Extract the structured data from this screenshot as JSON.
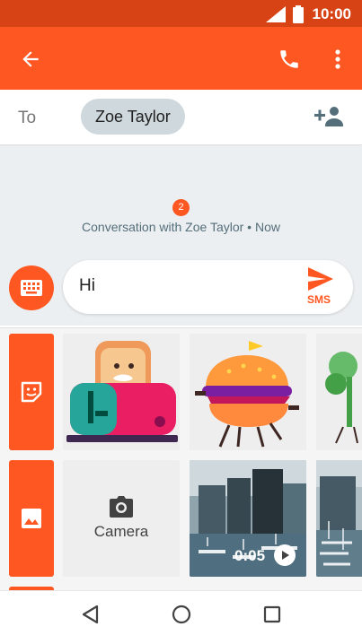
{
  "status_bar": {
    "time": "10:00",
    "icons": [
      "signal-icon",
      "battery-icon"
    ]
  },
  "colors": {
    "primary": "#ff5722",
    "status": "#d84315",
    "chip": "#cfd8dc",
    "background": "#eceff1"
  },
  "app_bar": {
    "icons": [
      "back-arrow-icon",
      "phone-icon",
      "more-vert-icon"
    ]
  },
  "to_row": {
    "label": "To",
    "recipient": "Zoe Taylor",
    "icon": "add-person-icon"
  },
  "conversation": {
    "badge": "2",
    "title": "Conversation with Zoe Taylor • Now"
  },
  "compose": {
    "value": "Hi",
    "send_label": "SMS",
    "icons": [
      "keyboard-icon",
      "send-icon"
    ]
  },
  "media": {
    "tabs": [
      "sticker-icon",
      "image-icon"
    ],
    "camera_label": "Camera",
    "video_duration": "0:05"
  },
  "nav": {
    "icons": [
      "back-triangle-icon",
      "home-circle-icon",
      "recents-square-icon"
    ]
  }
}
